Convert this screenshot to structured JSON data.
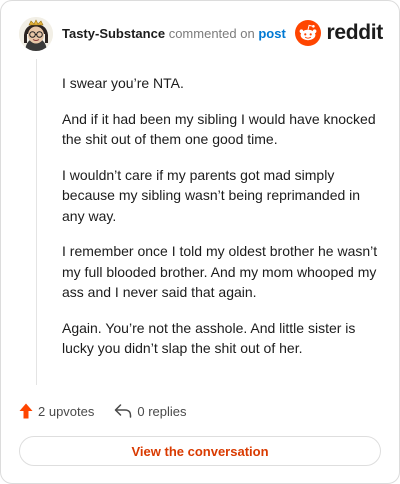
{
  "header": {
    "username": "Tasty-Substance",
    "verb": "commented on",
    "post_link": "post",
    "brand": "reddit"
  },
  "comment": {
    "paragraphs": [
      "I swear you’re NTA.",
      "And if it had been my sibling I would have knocked the shit out of them one good time.",
      "I wouldn’t care if my parents got mad simply because my sibling wasn’t being reprimanded in any way.",
      "I remember once I told my oldest brother he wasn’t my full blooded brother. And my mom whooped my ass and I never said that again.",
      "Again. You’re not the asshole. And little sister is lucky you didn’t slap the shit out of her."
    ]
  },
  "actions": {
    "upvotes": "2 upvotes",
    "replies": "0 replies"
  },
  "cta": {
    "label": "View the conversation"
  },
  "colors": {
    "accent": "#d93a00",
    "reddit_orange": "#ff4500",
    "link_blue": "#0079d3"
  },
  "icons": [
    "avatar",
    "reddit-logo-icon",
    "upvote-arrow-icon",
    "reply-icon"
  ]
}
